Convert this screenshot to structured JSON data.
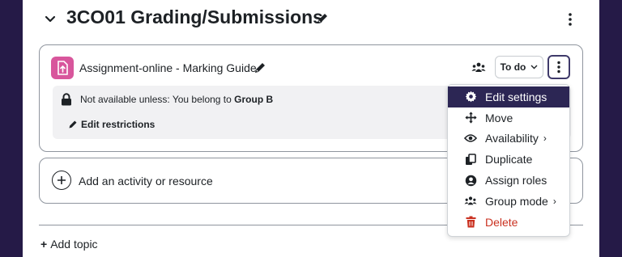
{
  "section": {
    "title": "3CO01 Grading/Submissions"
  },
  "activity": {
    "name": "Assignment-online - Marking Guide",
    "todo_label": "To do",
    "restriction_prefix": "Not available unless: You belong to ",
    "restriction_group": "Group B",
    "edit_restrictions_label": "Edit restrictions"
  },
  "add_activity_label": "Add an activity or resource",
  "add_topic_label": "Add topic",
  "menu": {
    "items": [
      {
        "label": "Edit settings",
        "icon": "gear-icon"
      },
      {
        "label": "Move",
        "icon": "move-arrows-icon"
      },
      {
        "label": "Availability",
        "icon": "eye-icon"
      },
      {
        "label": "Duplicate",
        "icon": "copy-icon"
      },
      {
        "label": "Assign roles",
        "icon": "user-circle-icon"
      },
      {
        "label": "Group mode",
        "icon": "group-icon"
      },
      {
        "label": "Delete",
        "icon": "trash-icon"
      }
    ]
  },
  "colors": {
    "background": "#251a47",
    "assignment_icon": "#d8569c",
    "menu_active": "#2c2654",
    "danger": "#ca3120"
  }
}
